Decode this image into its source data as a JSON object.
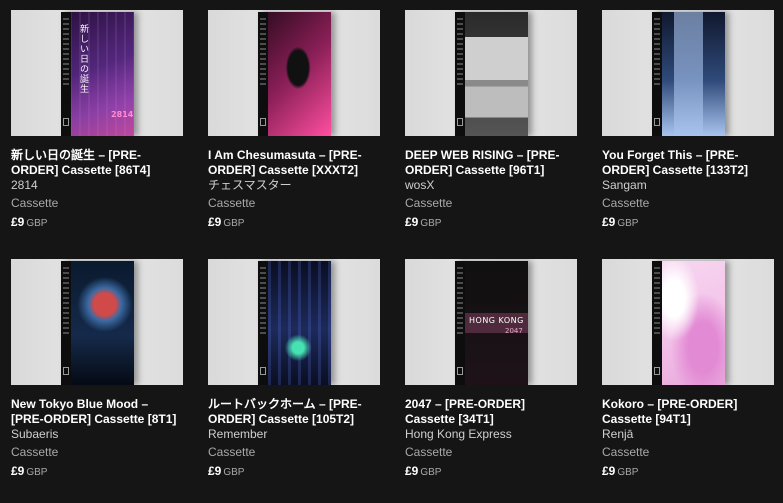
{
  "items": [
    {
      "title": "新しい日の誕生 – [PRE-ORDER] Cassette [86T4]",
      "artist": "2814",
      "format": "Cassette",
      "price": "£9",
      "currency": "GBP",
      "art_colors": [
        "#2a0f3e",
        "#7a3fa8",
        "#ff5fd2"
      ],
      "art_caption": "新しい日の誕生",
      "art_label": "2814"
    },
    {
      "title": "I Am Chesumasuta – [PRE-ORDER] Cassette [XXXT2]",
      "artist": "チェスマスター",
      "format": "Cassette",
      "price": "£9",
      "currency": "GBP",
      "art_colors": [
        "#2b0a1d",
        "#c23a78",
        "#ff4fa0"
      ]
    },
    {
      "title": "DEEP WEB RISING – [PRE-ORDER] Cassette [96T1]",
      "artist": "wosX",
      "format": "Cassette",
      "price": "£9",
      "currency": "GBP",
      "art_colors": [
        "#3a3a3a",
        "#a8a8a8",
        "#dcdcdc"
      ]
    },
    {
      "title": "You Forget This – [PRE-ORDER] Cassette [133T2]",
      "artist": "Sangam",
      "format": "Cassette",
      "price": "£9",
      "currency": "GBP",
      "art_colors": [
        "#10182e",
        "#3f5f9a",
        "#a8c4ee"
      ]
    },
    {
      "title": "New Tokyo Blue Mood – [PRE-ORDER] Cassette [8T1]",
      "artist": "Subaeris",
      "format": "Cassette",
      "price": "£9",
      "currency": "GBP",
      "art_colors": [
        "#0a1a2e",
        "#3c6aa3",
        "#d14a4a"
      ]
    },
    {
      "title": "ルートバックホーム – [PRE-ORDER] Cassette [105T2]",
      "artist": "Remember",
      "format": "Cassette",
      "price": "£9",
      "currency": "GBP",
      "art_colors": [
        "#0a0e22",
        "#2c3f80",
        "#47e2b3"
      ]
    },
    {
      "title": "2047 – [PRE-ORDER] Cassette [34T1]",
      "artist": "Hong Kong Express",
      "format": "Cassette",
      "price": "£9",
      "currency": "GBP",
      "art_colors": [
        "#101010",
        "#3a1a2a",
        "#b85a8a"
      ],
      "art_caption": "HONG KONG",
      "art_label": "2047"
    },
    {
      "title": "Kokoro – [PRE-ORDER] Cassette [94T1]",
      "artist": "Renjā",
      "format": "Cassette",
      "price": "£9",
      "currency": "GBP",
      "art_colors": [
        "#f3c4ea",
        "#e28ad4",
        "#ffffff"
      ]
    }
  ]
}
